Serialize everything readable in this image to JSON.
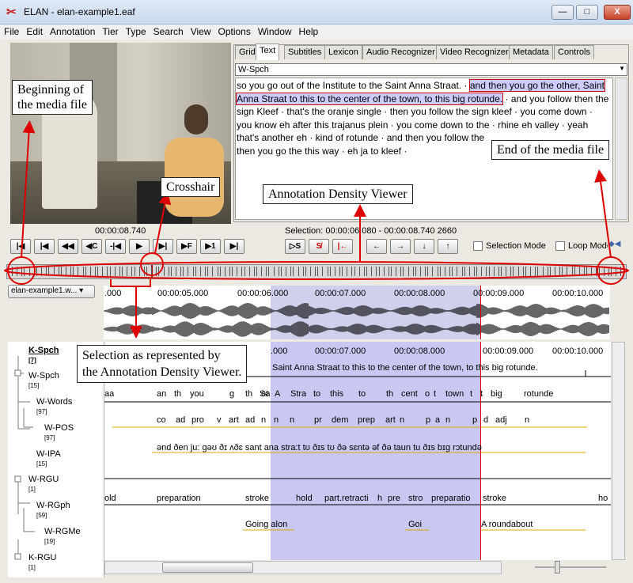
{
  "window": {
    "title": "ELAN - elan-example1.eaf",
    "app_icon": "elan-logo-icon",
    "minimize": "—",
    "maximize": "□",
    "close": "X"
  },
  "menu": [
    "File",
    "Edit",
    "Annotation",
    "Tier",
    "Type",
    "Search",
    "View",
    "Options",
    "Window",
    "Help"
  ],
  "tabs": [
    "Grid",
    "Text",
    "Subtitles",
    "Lexicon",
    "Audio Recognizer",
    "Video Recognizer",
    "Metadata",
    "Controls"
  ],
  "active_tab": "Text",
  "text_viewer": {
    "tier": "W-Spch",
    "lines": [
      {
        "pre": "so you go out of the Institute to the Saint Anna Straat.  ·  ",
        "hl": "and then you go the other, Saint"
      },
      {
        "hl": "Anna Straat to this to the center of the town, to this big rotunde.",
        "post": "  ·  and you follow then the"
      },
      {
        "pre": "sign Kleef  ·  that's the oranje single  ·  then you follow the sign kleef  ·  you come down  ·"
      },
      {
        "pre": "you know eh after this trajanus plein  ·  you come down to the  ·  rhine eh valley  ·  yeah"
      },
      {
        "pre": "that's another eh  ·  kind of rotunde  ·  and then you follow the"
      },
      {
        "pre": "then you go the this way  ·  eh ja to kleef  ·"
      }
    ]
  },
  "media_time": "00:00:08.740",
  "selection_info": "Selection: 00:00:06.080 - 00:00:08.740  2660",
  "transport_buttons": [
    "|◀",
    "|◀",
    "◀◀",
    "◀C",
    "-|◀",
    "▶",
    "▶|",
    "▶F",
    "▶1",
    "▶|"
  ],
  "selection_buttons": [
    "▷S",
    "S̸",
    "|←"
  ],
  "nav_buttons": [
    "←",
    "→",
    "↓",
    "↑"
  ],
  "selection_mode": {
    "label": "Selection Mode",
    "checked": false
  },
  "loop_mode": {
    "label": "Loop Mode",
    "checked": false
  },
  "media_select": "elan-example1.w...",
  "ruler": [
    "00:00:05.000",
    "00:00:06.000",
    "00:00:07.000",
    "00:00:08.000",
    "00:00:09.000",
    "00:00:10.000"
  ],
  "ruler_partial": ".000",
  "tiers": [
    {
      "name": "K-Spch",
      "count": "[7]",
      "color": "#cc2222",
      "bold": true
    },
    {
      "name": "W-Spch",
      "count": "[15]",
      "color": "#a02020"
    },
    {
      "name": "W-Words",
      "count": "[97]",
      "color": "#a02020"
    },
    {
      "name": "W-POS",
      "count": "[97]",
      "color": "#a02020"
    },
    {
      "name": "W-IPA",
      "count": "[15]",
      "color": "#a02020"
    },
    {
      "name": "W-RGU",
      "count": "[1]",
      "color": "#5050a0"
    },
    {
      "name": "W-RGph",
      "count": "[59]",
      "color": "#5050a0"
    },
    {
      "name": "W-RGMe",
      "count": "[19]",
      "color": "#5050a0"
    },
    {
      "name": "K-RGU",
      "count": "[1]",
      "color": "#a050a0"
    }
  ],
  "annotations": {
    "w_spch": "Saint Anna Straat to this to the center of the town, to this big rotunde.",
    "w_words": [
      "aa",
      "an",
      "th",
      "you",
      "g",
      "th",
      "ot",
      "Sa",
      "A",
      "Stra",
      "to",
      "this",
      "to",
      "th",
      "cent",
      "o",
      "t",
      "town",
      "t",
      "t",
      "big",
      "rotunde"
    ],
    "w_pos": [
      "co",
      "ad",
      "pro",
      "v",
      "art",
      "ad",
      "n",
      "n",
      "n",
      "pr",
      "dem",
      "prep",
      "art",
      "n",
      "p",
      "a",
      "n",
      "p",
      "d",
      "adj",
      "n"
    ],
    "w_ipa": "ənd ðen ju: ɡəʊ ðɪ ʌðɛ sant ana stra:t tʊ ðɪs tʊ ðə sɛntə əf ðə taun tu ðɪs bɪɡ rɔtundə",
    "w_rgph": [
      "old",
      "preparation",
      "stroke",
      "hold",
      "part.retracti",
      "h",
      "pre",
      "stro",
      "preparatio",
      "stroke",
      "ho"
    ],
    "w_rgme": [
      "Going alon",
      "Goi",
      "A roundabout"
    ]
  },
  "callouts": {
    "beginning": [
      "Beginning of",
      "the media file"
    ],
    "crosshair": "Crosshair",
    "density": "Annotation Density Viewer",
    "end": "End of the media file",
    "selection": [
      "Selection as represented by",
      "the Annotation Density Viewer."
    ]
  },
  "colors": {
    "selection": "#c8c8f2",
    "cursor": "#dd0000",
    "annotation_line": "#e0a800",
    "callout_line": "#dd0000"
  }
}
